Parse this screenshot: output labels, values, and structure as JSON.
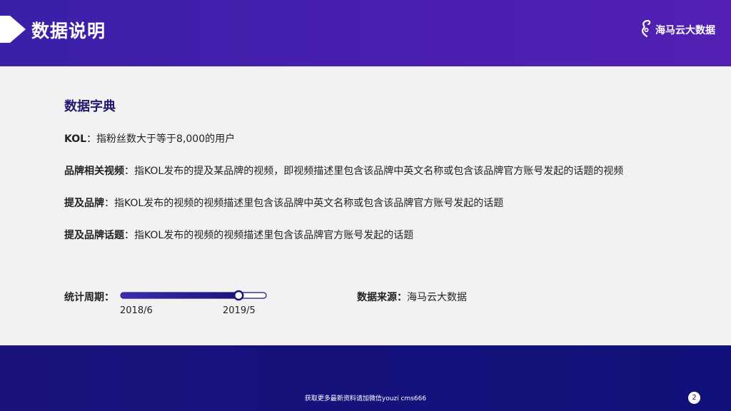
{
  "header": {
    "title": "数据说明",
    "brand": {
      "name": "海马云大数据",
      "icon": "seahorse-logo-icon"
    }
  },
  "dictionary": {
    "heading": "数据字典",
    "items": [
      {
        "term": "KOL",
        "separator": "：",
        "definition": "指粉丝数大于等于8,000的用户"
      },
      {
        "term": "品牌相关视频",
        "separator": "：",
        "definition": "指KOL发布的提及某品牌的视频，即视频描述里包含该品牌中英文名称或包含该品牌官方账号发起的话题的视频"
      },
      {
        "term": "提及品牌",
        "separator": "：",
        "definition": "指KOL发布的视频的视频描述里包含该品牌中英文名称或包含该品牌官方账号发起的话题"
      },
      {
        "term": "提及品牌话题",
        "separator": "：",
        "definition": "指KOL发布的视频的视频描述里包含该品牌官方账号发起的话题"
      }
    ]
  },
  "period": {
    "label": "统计周期：",
    "start": "2018/6",
    "end": "2019/5",
    "progress": 0.82
  },
  "source": {
    "label": "数据来源：",
    "value": "海马云大数据"
  },
  "footer": {
    "note": "获取更多最新资料请加微信youzi cms666",
    "page": "2"
  },
  "colors": {
    "header": "#4a1fb0",
    "footer": "#1a137e",
    "heading": "#1e1a6e",
    "track_fill": "#2a1a9e"
  }
}
